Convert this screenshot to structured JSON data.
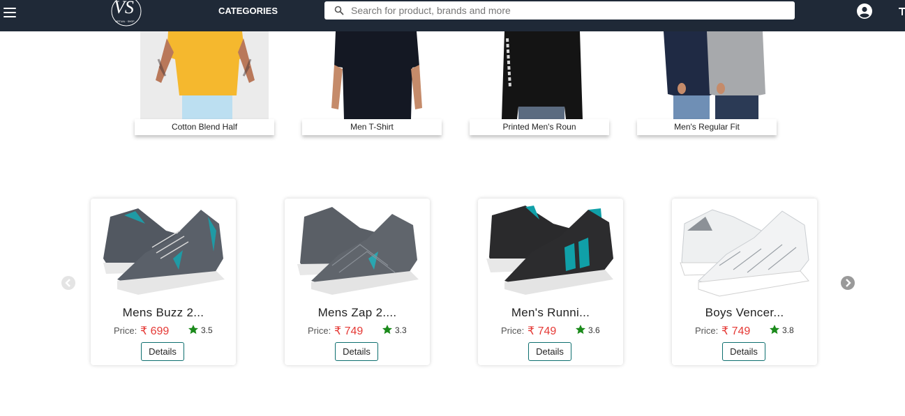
{
  "header": {
    "logo_text": "VS",
    "logo_subtext": "VIRTUAL SHOP",
    "categories_label": "CATEGORIES",
    "search_placeholder": "Search for product, brands and more"
  },
  "categories": [
    {
      "label": "Cotton Blend Half",
      "shirt_color": "#f5b82e"
    },
    {
      "label": "Men T-Shirt",
      "shirt_color": "#141823"
    },
    {
      "label": "Printed Men's Roun",
      "shirt_color": "#141414"
    },
    {
      "label": "Men's Regular Fit",
      "shirt_color": "#1f2a44"
    }
  ],
  "products": [
    {
      "name": "Mens Buzz 2...",
      "price_label": "Price:",
      "price": "₹ 699",
      "rating": "3.5",
      "details_label": "Details",
      "shoe_color": "#525861",
      "accent_color": "#1f9aa5"
    },
    {
      "name": "Mens Zap 2....",
      "price_label": "Price:",
      "price": "₹ 749",
      "rating": "3.3",
      "details_label": "Details",
      "shoe_color": "#5a5f66",
      "accent_color": "#2aa6b0"
    },
    {
      "name": "Men's Runni...",
      "price_label": "Price:",
      "price": "₹ 749",
      "rating": "3.6",
      "details_label": "Details",
      "shoe_color": "#2a2a2c",
      "accent_color": "#10a0a8"
    },
    {
      "name": "Boys Vencer...",
      "price_label": "Price:",
      "price": "₹ 749",
      "rating": "3.8",
      "details_label": "Details",
      "shoe_color": "#eef0f1",
      "accent_color": "#9aa0a6"
    }
  ],
  "colors": {
    "header_bg": "#1f2937",
    "price": "#e53935",
    "star": "#1b8a1b",
    "button_border": "#0d6e6e"
  }
}
